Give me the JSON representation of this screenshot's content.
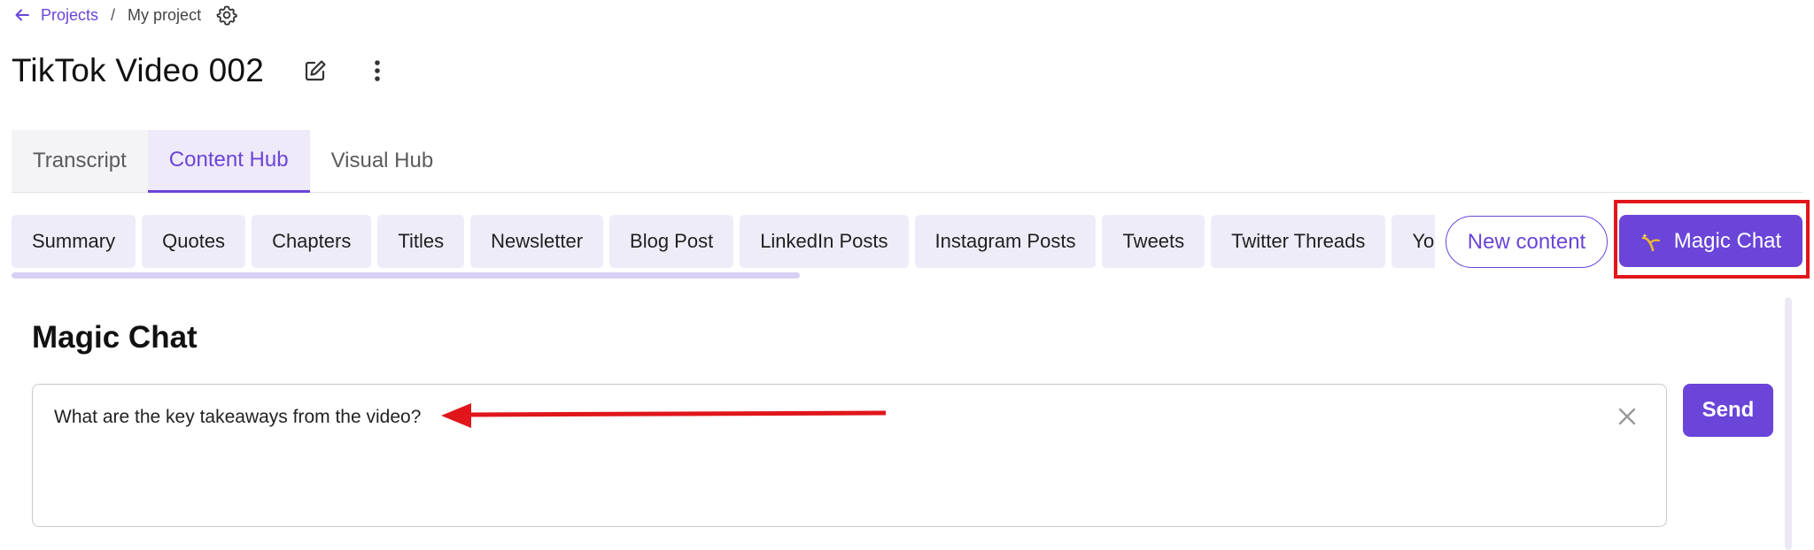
{
  "breadcrumb": {
    "back_icon": "arrow-left-icon",
    "projects_label": "Projects",
    "separator": "/",
    "current_label": "My project",
    "settings_icon": "gear-icon"
  },
  "header": {
    "title": "TikTok Video 002",
    "edit_icon": "edit-icon",
    "more_icon": "more-vertical-icon"
  },
  "tabs": [
    {
      "label": "Transcript",
      "active": false
    },
    {
      "label": "Content Hub",
      "active": true
    },
    {
      "label": "Visual Hub",
      "active": false
    }
  ],
  "content_types": [
    "Summary",
    "Quotes",
    "Chapters",
    "Titles",
    "Newsletter",
    "Blog Post",
    "LinkedIn Posts",
    "Instagram Posts",
    "Tweets",
    "Twitter Threads",
    "YouTube"
  ],
  "actions": {
    "new_content_label": "New content",
    "magic_chat_label": "Magic Chat",
    "magic_chat_icon": "sparkle-icon"
  },
  "magic_chat": {
    "heading": "Magic Chat",
    "input_value": "What are the key takeaways from the video?",
    "clear_icon": "close-icon",
    "send_label": "Send"
  },
  "colors": {
    "accent": "#6a45d8",
    "chip_bg": "#efecf9",
    "annotation": "#e0161b"
  }
}
